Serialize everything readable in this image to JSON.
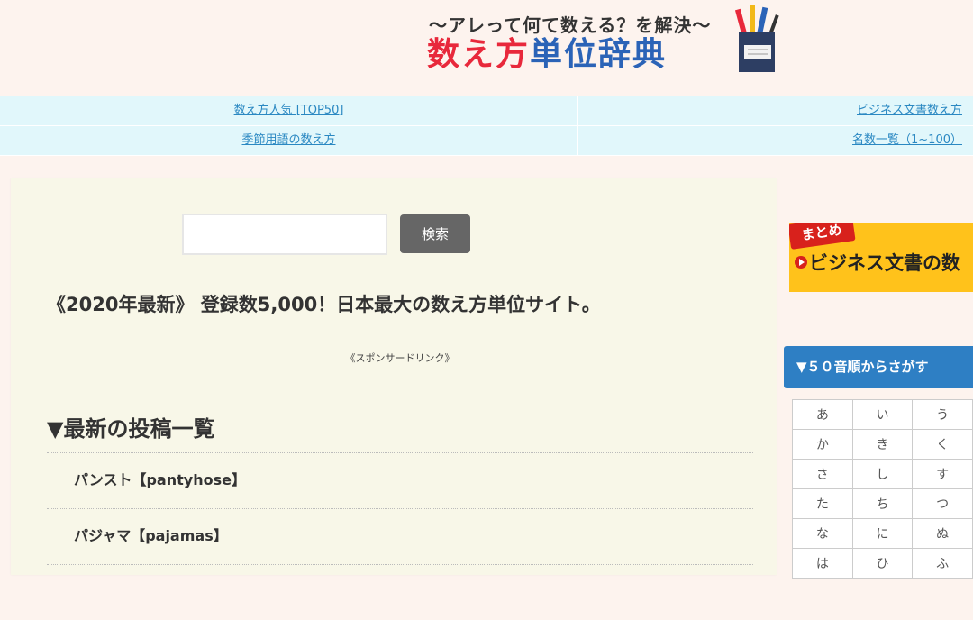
{
  "header": {
    "subtitle": "〜アレって何て数える？を解決〜",
    "title_red": "数え方",
    "title_blue": "単位辞典",
    "colors": {
      "red": "#e8283b",
      "blue": "#2b63b7"
    }
  },
  "nav": {
    "rows": [
      {
        "left": "数え方人気 [TOP50]",
        "right": "ビジネス文書数え方"
      },
      {
        "left": "季節用語の数え方",
        "right": "名数一覧（1~100）"
      }
    ]
  },
  "search": {
    "value": "",
    "button_label": "検索"
  },
  "headline": "《2020年最新》 登録数5,000！日本最大の数え方単位サイト。",
  "sponsor": "《スポンサードリンク》",
  "latest": {
    "title": "▼最新の投稿一覧",
    "posts": [
      "パンスト【pantyhose】",
      "パジャマ【pajamas】"
    ]
  },
  "sidebar": {
    "banner": {
      "tag": "まとめ",
      "text": "ビジネス文書の数"
    },
    "gojuon": {
      "title": "▼５０音順からさがす",
      "rows": [
        [
          "あ",
          "い",
          "う"
        ],
        [
          "か",
          "き",
          "く"
        ],
        [
          "さ",
          "し",
          "す"
        ],
        [
          "た",
          "ち",
          "つ"
        ],
        [
          "な",
          "に",
          "ぬ"
        ],
        [
          "は",
          "ひ",
          "ふ"
        ]
      ]
    }
  }
}
